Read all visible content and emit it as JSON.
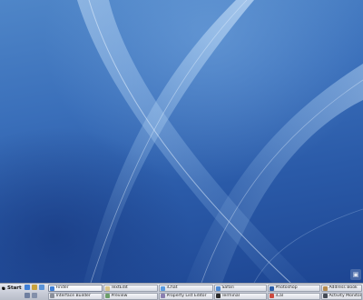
{
  "start": {
    "label": "Start"
  },
  "colors": {
    "taskbar": "#c9cdd8",
    "desktop_dark": "#1d4592",
    "desktop_light": "#6aa2dc"
  },
  "quick_launch": [
    "finder-icon",
    "mail-icon",
    "safari-icon"
  ],
  "tasks_row1": [
    {
      "label": "Finder",
      "icon": "finder-icon",
      "color": "#3f7fd6",
      "active": true
    },
    {
      "label": "TextEdit",
      "icon": "textedit-icon",
      "color": "#d9c489"
    },
    {
      "label": "iChat",
      "icon": "ichat-icon",
      "color": "#5a9be0"
    },
    {
      "label": "Safari",
      "icon": "safari-icon",
      "color": "#4c8ad6"
    },
    {
      "label": "Photoshop",
      "icon": "photoshop-icon",
      "color": "#2c5ea8"
    },
    {
      "label": "Address Book",
      "icon": "addressbook-icon",
      "color": "#b48a4f"
    }
  ],
  "tasks_row2": [
    {
      "label": "Interface Builder",
      "icon": "interface-builder-icon",
      "color": "#8a8f99"
    },
    {
      "label": "Preview",
      "icon": "preview-icon",
      "color": "#6c9e6a"
    },
    {
      "label": "Property List Editor",
      "icon": "plist-editor-icon",
      "color": "#8b7fb0"
    },
    {
      "label": "Terminal",
      "icon": "terminal-icon",
      "color": "#2a2a2a"
    },
    {
      "label": "iCal",
      "icon": "ical-icon",
      "color": "#cc4a3f"
    },
    {
      "label": "Activity Monitor",
      "icon": "activity-monitor-icon",
      "color": "#444a55"
    }
  ]
}
